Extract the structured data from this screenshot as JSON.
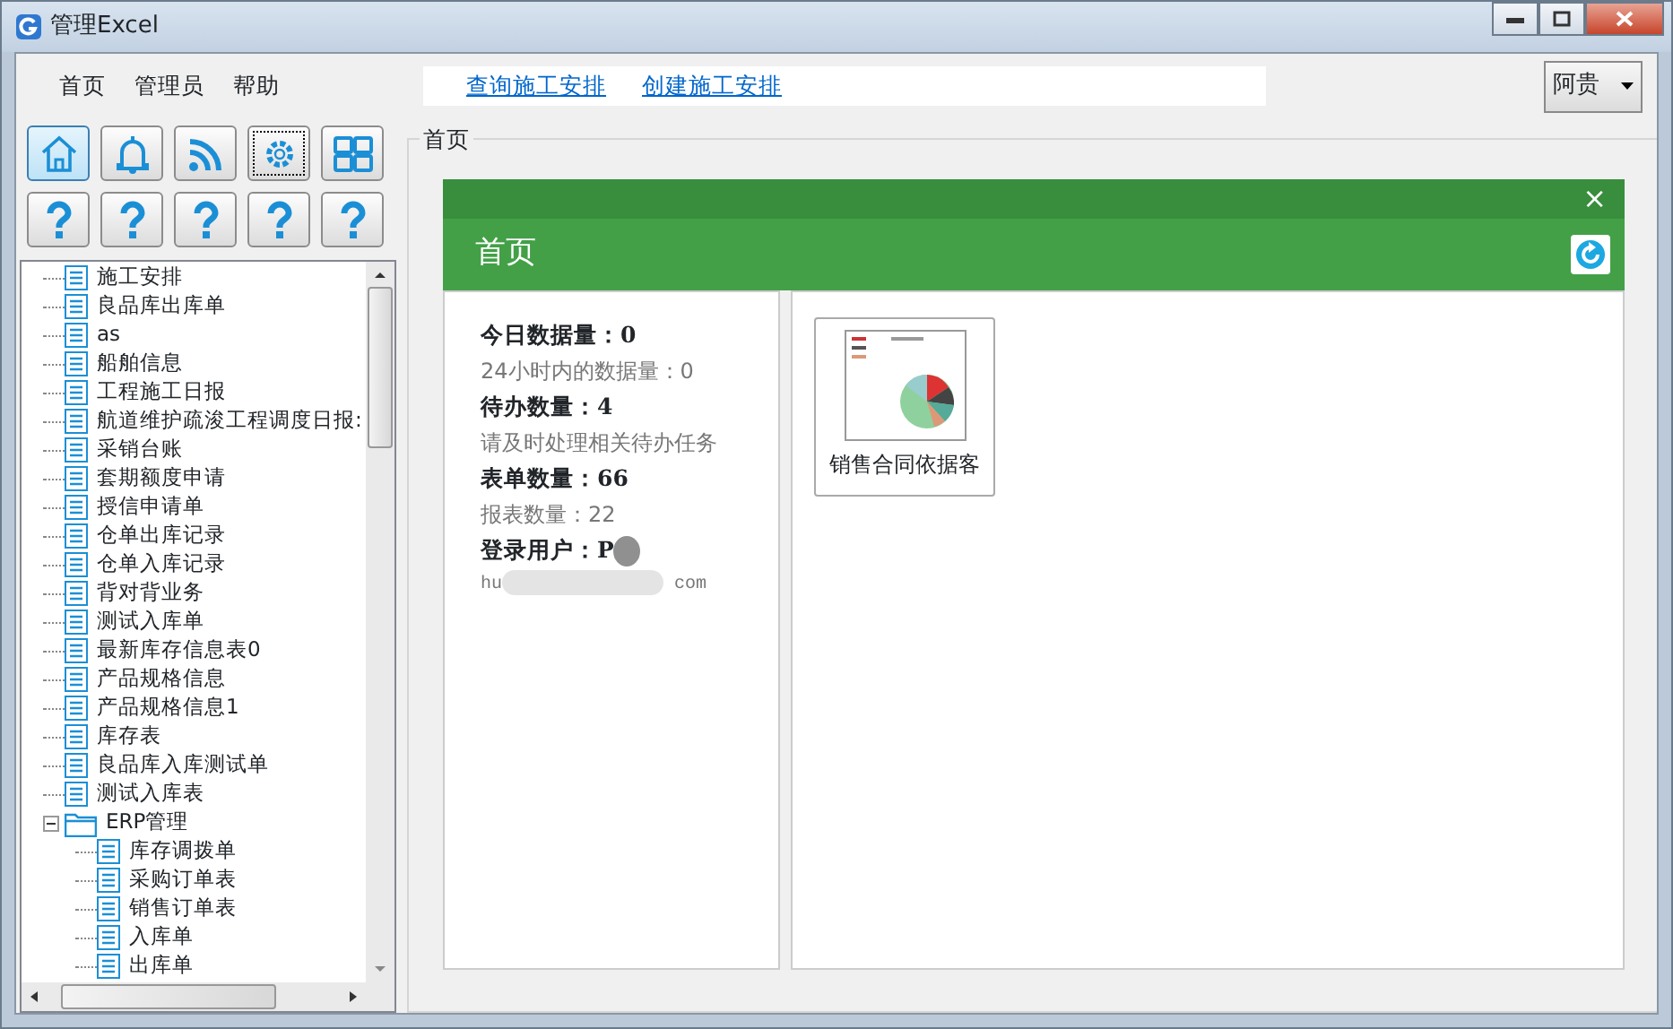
{
  "window": {
    "title": "管理Excel"
  },
  "menu": [
    {
      "label": "首页"
    },
    {
      "label": "管理员"
    },
    {
      "label": "帮助"
    }
  ],
  "links": [
    "查询施工安排",
    "创建施工安排"
  ],
  "user_dropdown": {
    "value": "阿贵"
  },
  "toolbar": [
    {
      "kind": "home",
      "selected": true,
      "focused": false
    },
    {
      "kind": "bell",
      "selected": false,
      "focused": false
    },
    {
      "kind": "rss",
      "selected": false,
      "focused": false
    },
    {
      "kind": "gear",
      "selected": false,
      "focused": true
    },
    {
      "kind": "grid",
      "selected": false,
      "focused": false
    },
    {
      "kind": "help",
      "selected": false,
      "focused": false
    },
    {
      "kind": "help",
      "selected": false,
      "focused": false
    },
    {
      "kind": "help",
      "selected": false,
      "focused": false
    },
    {
      "kind": "help",
      "selected": false,
      "focused": false
    },
    {
      "kind": "help",
      "selected": false,
      "focused": false
    }
  ],
  "tree": [
    {
      "label": "施工安排",
      "kind": "leaf"
    },
    {
      "label": "良品库出库单",
      "kind": "leaf"
    },
    {
      "label": "as",
      "kind": "leaf"
    },
    {
      "label": "船舶信息",
      "kind": "leaf"
    },
    {
      "label": "工程施工日报",
      "kind": "leaf"
    },
    {
      "label": "航道维护疏浚工程调度日报:",
      "kind": "leaf"
    },
    {
      "label": "采销台账",
      "kind": "leaf"
    },
    {
      "label": "套期额度申请",
      "kind": "leaf"
    },
    {
      "label": "授信申请单",
      "kind": "leaf"
    },
    {
      "label": "仓单出库记录",
      "kind": "leaf"
    },
    {
      "label": "仓单入库记录",
      "kind": "leaf"
    },
    {
      "label": "背对背业务",
      "kind": "leaf"
    },
    {
      "label": "测试入库单",
      "kind": "leaf"
    },
    {
      "label": "最新库存信息表0",
      "kind": "leaf"
    },
    {
      "label": "产品规格信息",
      "kind": "leaf"
    },
    {
      "label": "产品规格信息1",
      "kind": "leaf"
    },
    {
      "label": "库存表",
      "kind": "leaf"
    },
    {
      "label": "良品库入库测试单",
      "kind": "leaf"
    },
    {
      "label": "测试入库表",
      "kind": "leaf"
    },
    {
      "label": "ERP管理",
      "kind": "folder",
      "expanded": true,
      "children": [
        {
          "label": "库存调拨单",
          "kind": "leaf"
        },
        {
          "label": "采购订单表",
          "kind": "leaf"
        },
        {
          "label": "销售订单表",
          "kind": "leaf"
        },
        {
          "label": "入库单",
          "kind": "leaf"
        },
        {
          "label": "出库单",
          "kind": "leaf"
        }
      ]
    }
  ],
  "group_box": {
    "title": "首页"
  },
  "panel": {
    "title": "首页",
    "close": "×"
  },
  "stats": [
    {
      "kind": "heading",
      "text": "今日数据量：0"
    },
    {
      "kind": "note",
      "text": "24小时内的数据量：0"
    },
    {
      "kind": "heading",
      "text": "待办数量：4"
    },
    {
      "kind": "note",
      "text": "请及时处理相关待办任务"
    },
    {
      "kind": "heading",
      "text": "表单数量：66"
    },
    {
      "kind": "note",
      "text": "报表数量：22"
    },
    {
      "kind": "heading",
      "text": "登录用户：P"
    },
    {
      "kind": "email",
      "text": "hu"
    },
    {
      "kind": "email_end",
      "text": "com"
    }
  ],
  "tiles": [
    {
      "label": "销售合同依据客"
    }
  ]
}
